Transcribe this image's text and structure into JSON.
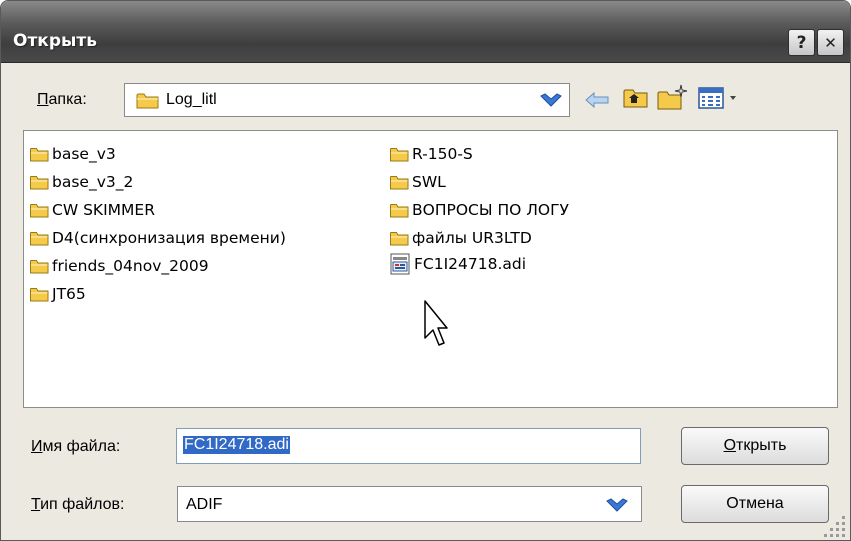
{
  "window": {
    "title": "Открыть"
  },
  "titlebar_buttons": {
    "help": "?",
    "close": "✕"
  },
  "folder_bar": {
    "label_underlined": "П",
    "label_rest": "апка:",
    "current_folder": "Log_litl"
  },
  "files": {
    "left_column": [
      "base_v3",
      "base_v3_2",
      "CW SKIMMER",
      "D4(синхронизация времени)",
      "friends_04nov_2009",
      "JT65"
    ],
    "right_column": [
      "R-150-S",
      "SWL",
      "ВОПРОСЫ ПО ЛОГУ",
      "файлы UR3LTD"
    ],
    "file_item": "FC1I24718.adi"
  },
  "filename": {
    "label_underlined": "И",
    "label_rest": "мя файла:",
    "value": "FC1I24718.adi"
  },
  "filetype": {
    "label_underlined": "Т",
    "label_rest": "ип файлов:",
    "value": "ADIF"
  },
  "buttons": {
    "open_underlined": "О",
    "open_rest": "ткрыть",
    "cancel": "Отмена"
  },
  "colors": {
    "selection": "#3169c6",
    "folder": "#f5c94a",
    "dialog_bg": "#ece9e0"
  }
}
